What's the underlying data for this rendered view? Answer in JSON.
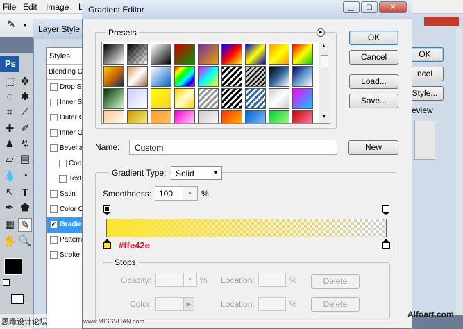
{
  "menubar": {
    "items": [
      "File",
      "Edit",
      "Image",
      "L"
    ]
  },
  "toolbox": {
    "logo": "Ps",
    "tool_t_label": "T"
  },
  "layer_style": {
    "title": "Layer Style",
    "styles_label": "Styles",
    "blending_label": "Blending O",
    "items": [
      {
        "label": "Drop S",
        "checked": false,
        "indent": false
      },
      {
        "label": "Inner S",
        "checked": false,
        "indent": false
      },
      {
        "label": "Outer G",
        "checked": false,
        "indent": false
      },
      {
        "label": "Inner G",
        "checked": false,
        "indent": false
      },
      {
        "label": "Bevel a",
        "checked": false,
        "indent": false
      },
      {
        "label": "Con",
        "checked": false,
        "indent": true
      },
      {
        "label": "Text",
        "checked": false,
        "indent": true
      },
      {
        "label": "Satin",
        "checked": false,
        "indent": false
      },
      {
        "label": "Color O",
        "checked": false,
        "indent": false
      },
      {
        "label": "Gradie",
        "checked": true,
        "indent": false,
        "selected": true
      },
      {
        "label": "Pattern",
        "checked": false,
        "indent": false
      },
      {
        "label": "Stroke",
        "checked": false,
        "indent": false
      }
    ]
  },
  "right_dialog": {
    "ok": "OK",
    "cancel": "ncel",
    "style": "Style...",
    "preview": "eview"
  },
  "gradient_editor": {
    "title": "Gradient Editor",
    "presets_label": "Presets",
    "buttons": {
      "ok": "OK",
      "cancel": "Cancel",
      "load": "Load...",
      "save": "Save...",
      "new": "New"
    },
    "name_label": "Name:",
    "name_value": "Custom",
    "gradient_type_label": "Gradient Type:",
    "gradient_type_value": "Solid",
    "smoothness_label": "Smoothness:",
    "smoothness_value": "100",
    "percent": "%",
    "color_annotation": "#ffe42e",
    "stops": {
      "label": "Stops",
      "opacity_label": "Opacity:",
      "color_label": "Color:",
      "location_label": "Location:",
      "percent": "%",
      "delete_label": "Delete"
    }
  },
  "colors": {
    "accent": "#ffe42e",
    "annotation_red": "#e8112d",
    "selection": "#3399ff"
  },
  "watermark": {
    "left": "思缘设计论坛",
    "mid": "www.MISSVUAN.com",
    "right": "Alfoart.com"
  }
}
